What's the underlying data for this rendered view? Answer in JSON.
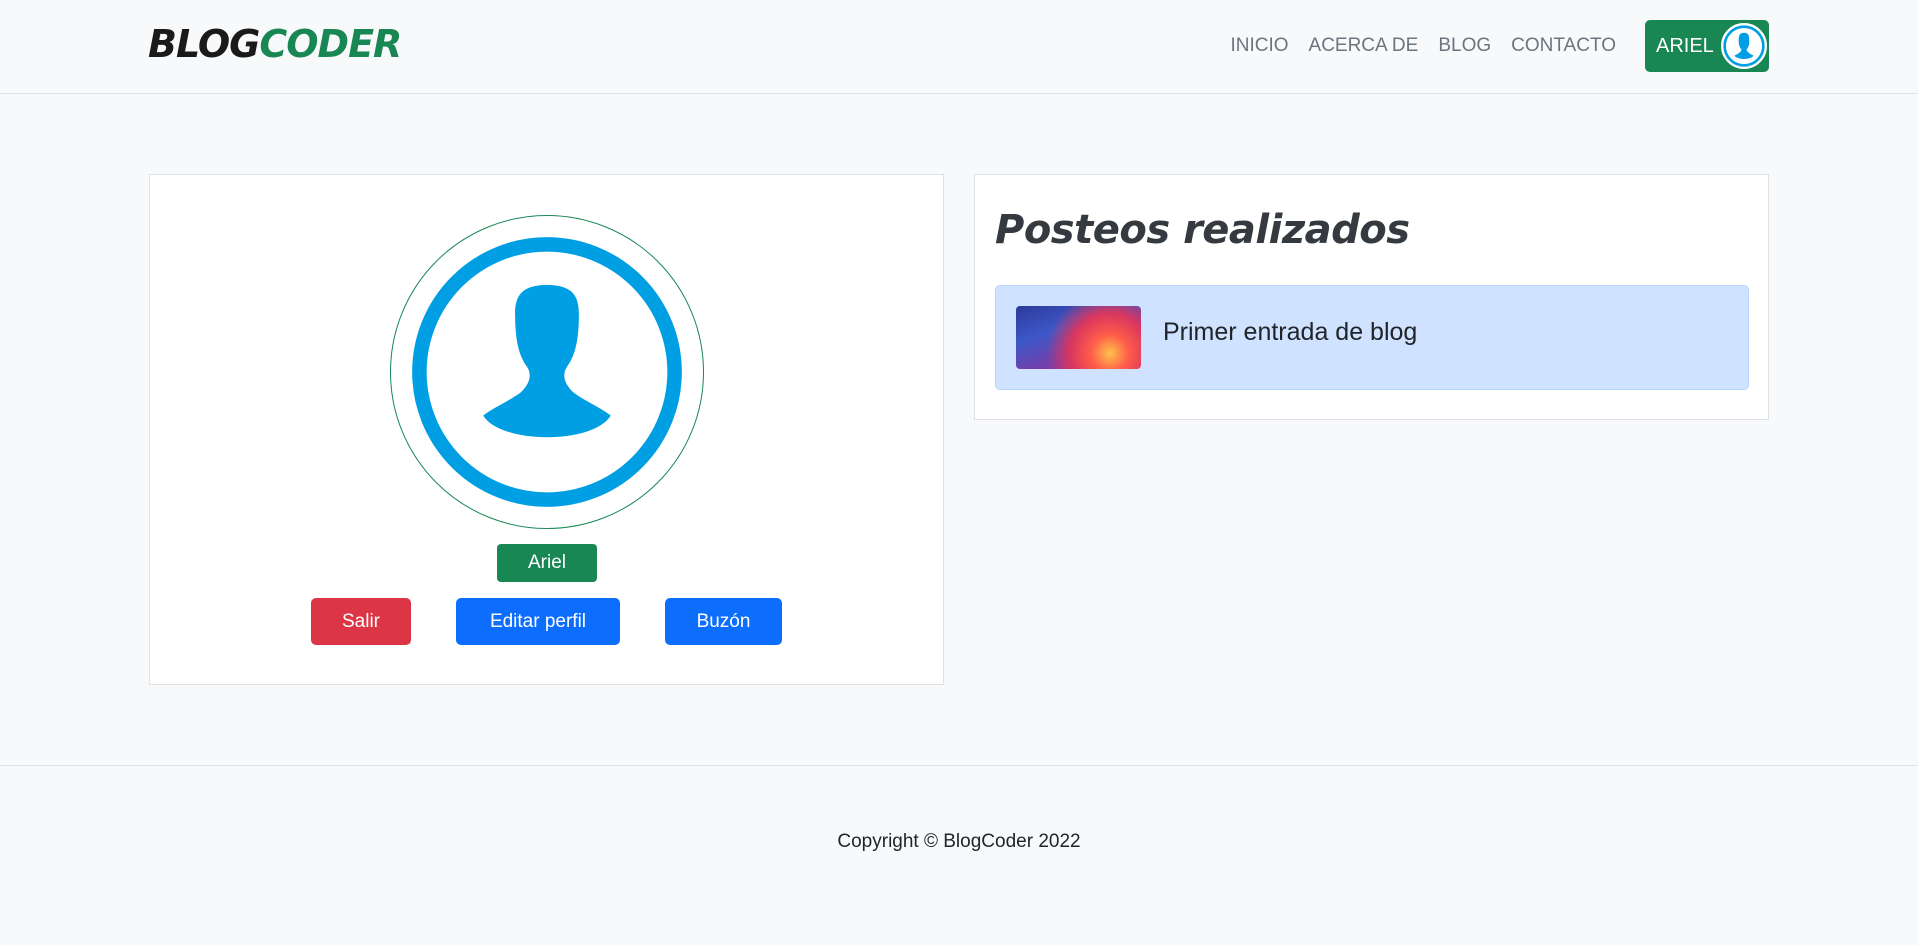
{
  "brand": {
    "part1": "BLOG",
    "part2": "CODER"
  },
  "nav": {
    "links": [
      "INICIO",
      "ACERCA DE",
      "BLOG",
      "CONTACTO"
    ],
    "user_label": "ARIEL"
  },
  "profile": {
    "name": "Ariel",
    "buttons": {
      "logout": "Salir",
      "edit": "Editar perfil",
      "inbox": "Buzón"
    }
  },
  "posts": {
    "title": "Posteos realizados",
    "items": [
      {
        "title": "Primer entrada de blog"
      }
    ]
  },
  "footer": {
    "copyright": "Copyright © BlogCoder 2022"
  },
  "colors": {
    "brand_green": "#198754",
    "danger": "#dc3545",
    "primary": "#0d6efd",
    "avatar_blue": "#009fe3",
    "post_bg": "#cfe2ff"
  },
  "icons": {
    "user_avatar": "user-avatar-icon"
  }
}
